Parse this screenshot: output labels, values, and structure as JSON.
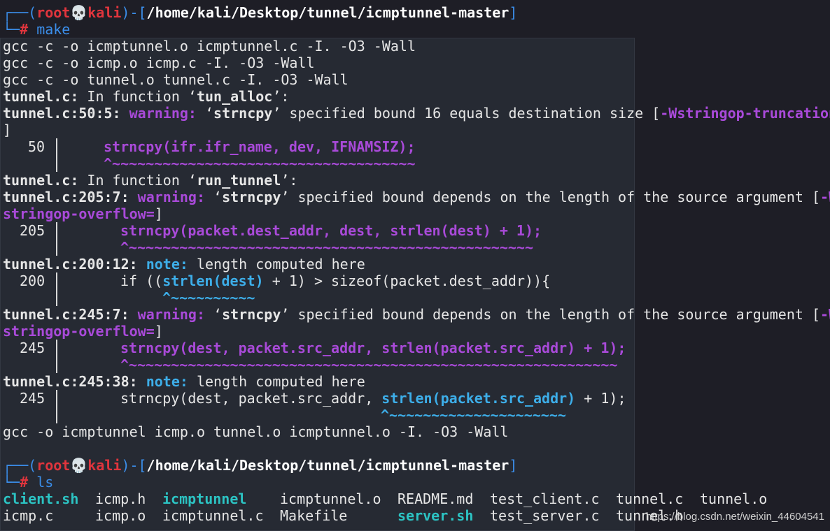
{
  "prompt1": {
    "user": "root",
    "skull": "💀",
    "host": "kali",
    "path": "/home/kali/Desktop/tunnel/icmptunnel-master",
    "cmd": "make"
  },
  "lines": {
    "l3": "gcc -c -o icmptunnel.o icmptunnel.c -I. -O3 -Wall",
    "l4": "gcc -c -o icmp.o icmp.c -I. -O3 -Wall",
    "l5": "gcc -c -o tunnel.o tunnel.c -I. -O3 -Wall",
    "l6a": "tunnel.c:",
    "l6b": " In function ‘",
    "l6c": "tun_alloc",
    "l6d": "’:",
    "l7a": "tunnel.c:50:5:",
    "l7b": " warning:",
    "l7c": " ‘",
    "l7d": "strncpy",
    "l7e": "’ specified bound 16 equals destination size [",
    "l7f": "-Wstringop-truncation",
    "l8": "]",
    "l9num": "50",
    "l9code": "strncpy(ifr.ifr_name, dev, IFNAMSIZ);",
    "l10": "^~~~~~~~~~~~~~~~~~~~~~~~~~~~~~~~~~~~~",
    "l11c": "run_tunnel",
    "l12a": "tunnel.c:205:7:",
    "l12e": "’ specified bound depends on the length of the source argument [",
    "l12f": "-W",
    "l13a": "stringop-overflow=",
    "l14num": "205",
    "l14code": "strncpy(packet.dest_addr, dest, strlen(dest) + 1);",
    "l15": "^~~~~~~~~~~~~~~~~~~~~~~~~~~~~~~~~~~~~~~~~~~~~~~~~",
    "l16a": "tunnel.c:200:12:",
    "l16b": " note:",
    "l16c": " length computed here",
    "l17num": "200",
    "l17pre": "if ((",
    "l17hl": "strlen(dest)",
    "l17post": " + 1) > sizeof(packet.dest_addr)){",
    "l18": "^~~~~~~~~~~",
    "l19a": "tunnel.c:245:7:",
    "l21num": "245",
    "l21code": "strncpy(dest, packet.src_addr, strlen(packet.src_addr) + 1);",
    "l22": "^~~~~~~~~~~~~~~~~~~~~~~~~~~~~~~~~~~~~~~~~~~~~~~~~~~~~~~~~~~",
    "l23a": "tunnel.c:245:38:",
    "l24pre": "strncpy(dest, packet.src_addr, ",
    "l24hl": "strlen(packet.src_addr)",
    "l24post": " + 1);",
    "l25": "^~~~~~~~~~~~~~~~~~~~~~",
    "l26": "gcc -o icmptunnel icmp.o tunnel.o icmptunnel.o -I. -O3 -Wall"
  },
  "prompt2": {
    "cmd": "ls"
  },
  "ls": {
    "r1": [
      "client.sh",
      "icmp.h",
      "icmptunnel",
      "icmptunnel.o",
      "README.md",
      "test_client.c",
      "tunnel.c",
      "tunnel.o"
    ],
    "r2": [
      "icmp.c",
      "icmp.o",
      "icmptunnel.c",
      "Makefile",
      "server.sh",
      "test_server.c",
      "tunnel.h"
    ]
  },
  "watermark": "https://blog.csdn.net/weixin_44604541"
}
